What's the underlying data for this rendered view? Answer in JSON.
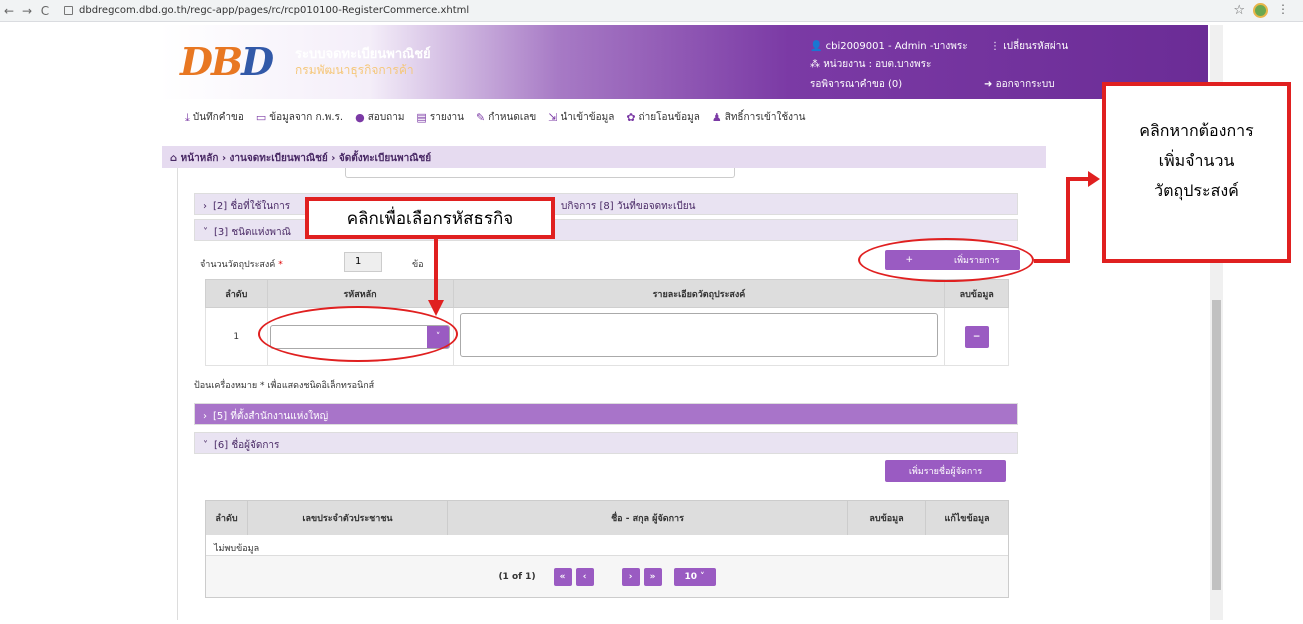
{
  "browser": {
    "url": "dbdregcom.dbd.go.th/regc-app/pages/rc/rcp010100-RegisterCommerce.xhtml"
  },
  "header": {
    "logo_text": "DBD",
    "system_name": "ระบบจดทะเบียนพาณิชย์",
    "dept_name": "กรมพัฒนาธุรกิจการค้า",
    "user": "cbi2009001 - Admin -บางพระ",
    "change_password": "เปลี่ยนรหัสผ่าน",
    "unit": "หน่วยงาน : อบต.บางพระ",
    "pending": "รอพิจารณาคำขอ (0)",
    "logout": "ออกจากระบบ"
  },
  "menu": [
    {
      "label": "บันทึกคำขอ",
      "icon": "download-icon"
    },
    {
      "label": "ข้อมูลจาก ก.พ.ร.",
      "icon": "monitor-icon"
    },
    {
      "label": "สอบถาม",
      "icon": "chat-icon"
    },
    {
      "label": "รายงาน",
      "icon": "document-icon"
    },
    {
      "label": "กำหนดเลข",
      "icon": "edit-icon"
    },
    {
      "label": "นำเข้าข้อมูล",
      "icon": "import-icon"
    },
    {
      "label": "ถ่ายโอนข้อมูล",
      "icon": "gear-icon"
    },
    {
      "label": "สิทธิ์การเข้าใช้งาน",
      "icon": "users-icon"
    }
  ],
  "breadcrumb": "หน้าหลัก › งานจดทะเบียนพาณิชย์ › จัดตั้งทะเบียนพาณิชย์",
  "sections": {
    "s2_left": "[2] ชื่อที่ใช้ในการ",
    "s2_right": "บกิจการ [8] วันที่ขอจดทะเบียน",
    "s3": "[3] ชนิดแห่งพาณิ",
    "s5": "[5] ที่ตั้งสำนักงานแห่งใหญ่",
    "s6": "[6] ชื่อผู้จัดการ"
  },
  "objective": {
    "qty_label": "จำนวนวัตถุประสงค์",
    "qty_value": "1",
    "qty_unit": "ข้อ",
    "add_button": "เพิ่มรายการ",
    "col_no": "ลำดับ",
    "col_code": "รหัสหลัก",
    "col_detail": "รายละเอียดวัตถุประสงค์",
    "col_delete": "ลบข้อมูล",
    "row_no": "1"
  },
  "note": "ป้อนเครื่องหมาย * เพื่อแสดงชนิดอิเล็กทรอนิกส์",
  "manager": {
    "add_button": "เพิ่มรายชื่อผู้จัดการ",
    "col_no": "ลำดับ",
    "col_id": "เลขประจำตัวประชาชน",
    "col_name": "ชื่อ - สกุล ผู้จัดการ",
    "col_delete": "ลบข้อมูล",
    "col_edit": "แก้ไขข้อมูล",
    "empty": "ไม่พบข้อมูล",
    "page_info": "(1 of 1)",
    "page_size": "10"
  },
  "annotations": {
    "code_hint": "คลิกเพื่อเลือกรหัสธรกิจ",
    "add_hint_1": "คลิกหากต้องการ",
    "add_hint_2": "เพิ่มจำนวน",
    "add_hint_3": "วัตถุประสงค์"
  },
  "colors": {
    "brand_purple": "#7b3aa5",
    "button_purple": "#9a5bc2",
    "annotation_red": "#e02020"
  }
}
